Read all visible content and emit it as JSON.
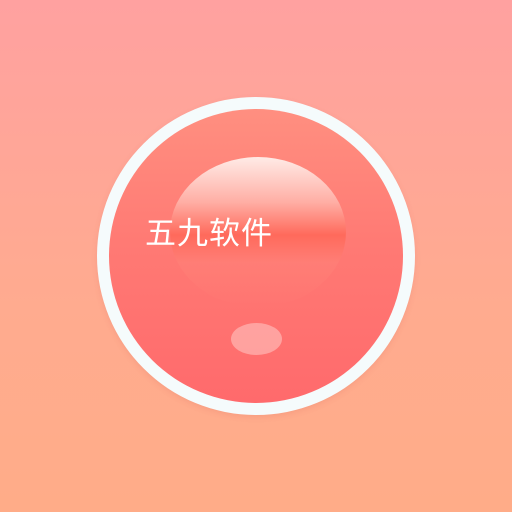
{
  "app_icon": {
    "brand_text": "五九软件",
    "colors": {
      "background_top": "#ffa1a0",
      "background_bottom": "#ffac88",
      "ring": "#f5fbfc",
      "ball": "#ff7a74",
      "text": "#ffffff"
    }
  }
}
